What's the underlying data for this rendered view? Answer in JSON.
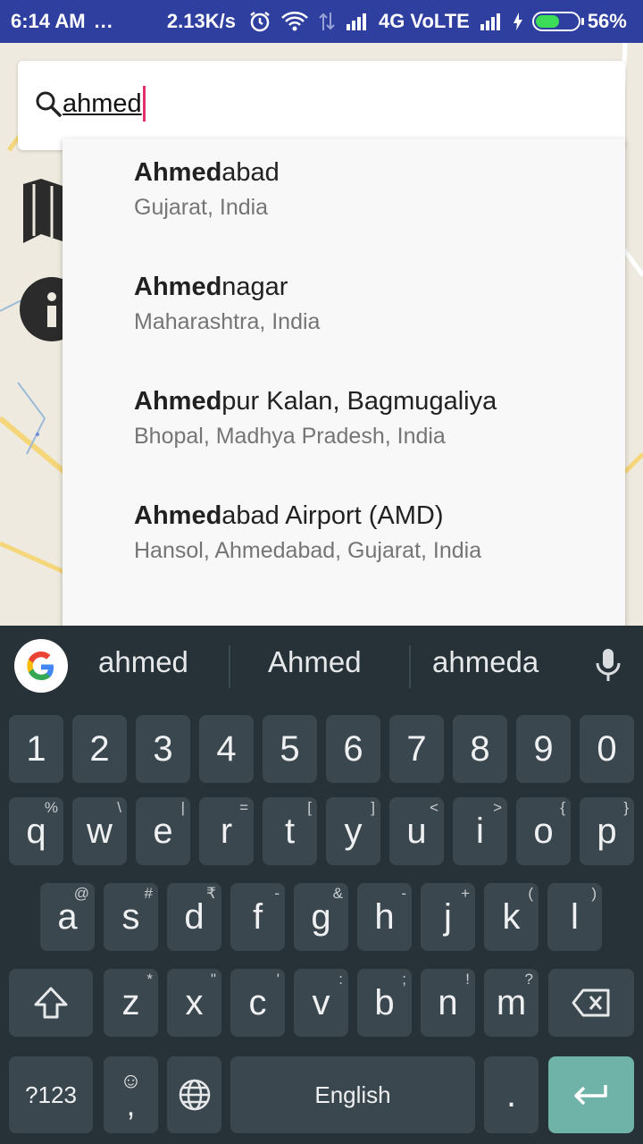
{
  "status_bar": {
    "time": "6:14 AM",
    "dots": "...",
    "speed": "2.13K/s",
    "network": "4G VoLTE",
    "battery": "56%",
    "battery_level": 0.56,
    "battery_color": "#3ddc58"
  },
  "search": {
    "query": "ahmed",
    "icon": "search-icon"
  },
  "suggestions": [
    {
      "match": "Ahmed",
      "rest": "abad",
      "subtitle": "Gujarat, India"
    },
    {
      "match": "Ahmed",
      "rest": "nagar",
      "subtitle": "Maharashtra, India"
    },
    {
      "match": "Ahmed",
      "rest": "pur Kalan, Bagmugaliya",
      "subtitle": "Bhopal, Madhya Pradesh, India"
    },
    {
      "match": "Ahmed",
      "rest": "abad Airport (AMD)",
      "subtitle": "Hansol, Ahmedabad, Gujarat, India"
    }
  ],
  "keyboard": {
    "suggestion_words": [
      "ahmed",
      "Ahmed",
      "ahmeda"
    ],
    "row_numbers": [
      "1",
      "2",
      "3",
      "4",
      "5",
      "6",
      "7",
      "8",
      "9",
      "0"
    ],
    "row1": [
      {
        "k": "q",
        "h": "%"
      },
      {
        "k": "w",
        "h": "\\"
      },
      {
        "k": "e",
        "h": "|"
      },
      {
        "k": "r",
        "h": "="
      },
      {
        "k": "t",
        "h": "["
      },
      {
        "k": "y",
        "h": "]"
      },
      {
        "k": "u",
        "h": "<"
      },
      {
        "k": "i",
        "h": ">"
      },
      {
        "k": "o",
        "h": "{"
      },
      {
        "k": "p",
        "h": "}"
      }
    ],
    "row2": [
      {
        "k": "a",
        "h": "@"
      },
      {
        "k": "s",
        "h": "#"
      },
      {
        "k": "d",
        "h": "₹"
      },
      {
        "k": "f",
        "h": "-"
      },
      {
        "k": "g",
        "h": "&"
      },
      {
        "k": "h",
        "h": "-"
      },
      {
        "k": "j",
        "h": "+"
      },
      {
        "k": "k",
        "h": "("
      },
      {
        "k": "l",
        "h": ")"
      }
    ],
    "row3": [
      {
        "k": "z",
        "h": "*"
      },
      {
        "k": "x",
        "h": "\""
      },
      {
        "k": "c",
        "h": "'"
      },
      {
        "k": "v",
        "h": ":"
      },
      {
        "k": "b",
        "h": ";"
      },
      {
        "k": "n",
        "h": "!"
      },
      {
        "k": "m",
        "h": "?"
      }
    ],
    "symbols_label": "?123",
    "emoji_label": "☺",
    "comma_label": ",",
    "space_label": "English",
    "period_label": ".",
    "accent_color": "#6fb3a8"
  }
}
